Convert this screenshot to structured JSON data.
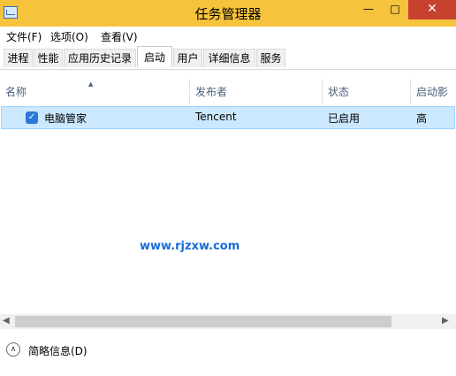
{
  "window": {
    "title": "任务管理器",
    "minimize_glyph": "—",
    "maximize_glyph": "□",
    "close_glyph": "✕"
  },
  "menu": {
    "file": "文件(F)",
    "options": "选项(O)",
    "view": "查看(V)"
  },
  "tabs": [
    {
      "label": "进程",
      "active": false
    },
    {
      "label": "性能",
      "active": false
    },
    {
      "label": "应用历史记录",
      "active": false
    },
    {
      "label": "启动",
      "active": true
    },
    {
      "label": "用户",
      "active": false
    },
    {
      "label": "详细信息",
      "active": false
    },
    {
      "label": "服务",
      "active": false
    }
  ],
  "table": {
    "columns": [
      "名称",
      "发布者",
      "状态",
      "启动影"
    ],
    "sort_glyph": "▲",
    "rows": [
      {
        "icon": "shield-icon",
        "name": "电脑管家",
        "publisher": "Tencent",
        "status": "已启用",
        "impact": "高",
        "selected": true
      }
    ]
  },
  "watermark": "www.rjzxw.com",
  "scrollbar": {
    "left_glyph": "◀",
    "right_glyph": "▶"
  },
  "footer": {
    "label": "简略信息(D)",
    "icon_glyph": "∧"
  },
  "colors": {
    "titlebar": "#f6c33d",
    "close": "#c7412f",
    "selection": "#cce8ff",
    "header_text": "#4c607a",
    "watermark": "#1a6bd8"
  }
}
